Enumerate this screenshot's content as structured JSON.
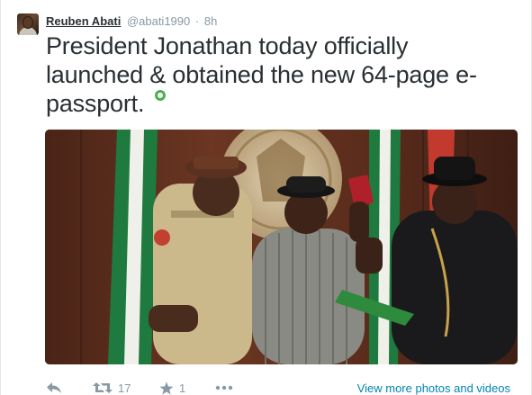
{
  "user": {
    "display_name": "Reuben Abati",
    "handle": "@abati1990",
    "separator": "·",
    "time": "8h"
  },
  "tweet": {
    "text": "President Jonathan today officially launched & obtained the new 64-page e-passport.",
    "location_icon": "geo-pin-icon"
  },
  "actions": {
    "reply_icon": "reply-icon",
    "retweet_icon": "retweet-icon",
    "retweet_count": "17",
    "favorite_icon": "star-icon",
    "favorite_count": "1",
    "more_icon": "more-dots-icon",
    "view_more": "View more photos and videos"
  },
  "colors": {
    "text": "#292f33",
    "muted": "#8899a6",
    "link": "#0084b4",
    "geo": "#4caf50"
  }
}
